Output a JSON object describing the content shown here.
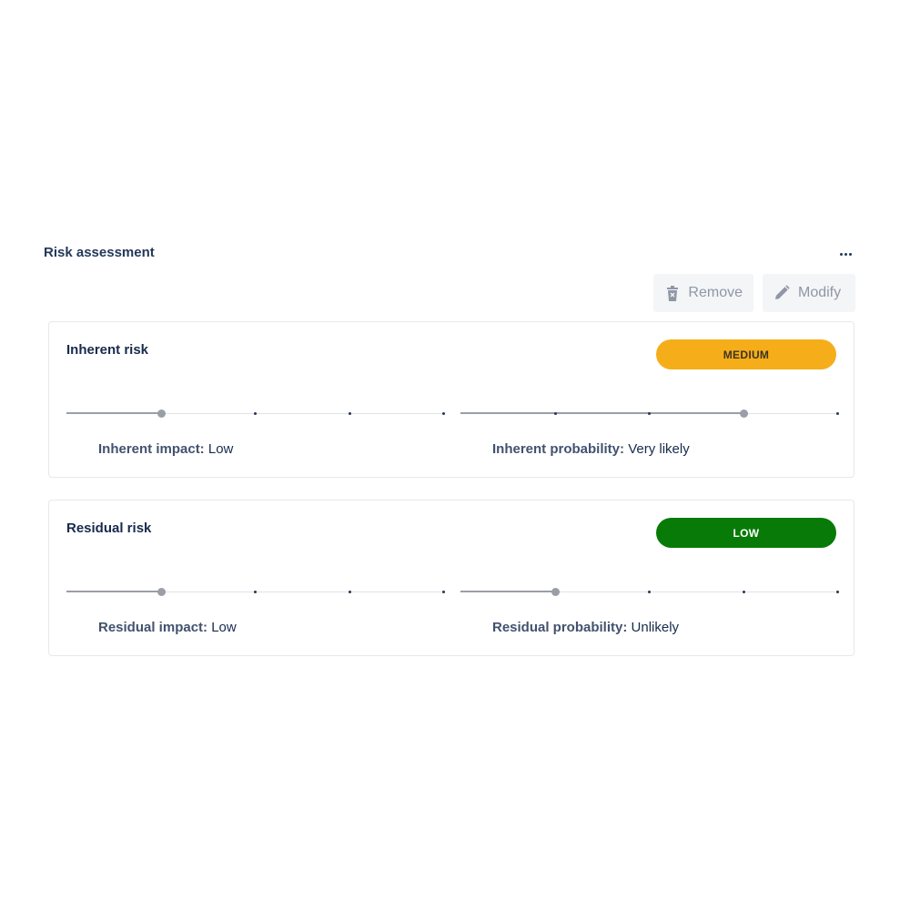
{
  "section": {
    "title": "Risk assessment"
  },
  "actions": {
    "remove_label": "Remove",
    "modify_label": "Modify"
  },
  "icons": {
    "more": "more-horizontal-icon",
    "remove": "trash-icon",
    "modify": "pencil-icon"
  },
  "colors": {
    "medium_badge": "#f5ae1a",
    "low_badge": "#087a08"
  },
  "inherent": {
    "title": "Inherent risk",
    "level": "MEDIUM",
    "impact_label": "Inherent impact:",
    "impact_value": "Low",
    "impact_level": 2,
    "impact_steps": 5,
    "probability_label": "Inherent probability:",
    "probability_value": "Very likely",
    "probability_level": 4,
    "probability_steps": 5
  },
  "residual": {
    "title": "Residual risk",
    "level": "LOW",
    "impact_label": "Residual impact:",
    "impact_value": "Low",
    "impact_level": 2,
    "impact_steps": 5,
    "probability_label": "Residual probability:",
    "probability_value": "Unlikely",
    "probability_level": 2,
    "probability_steps": 5
  }
}
